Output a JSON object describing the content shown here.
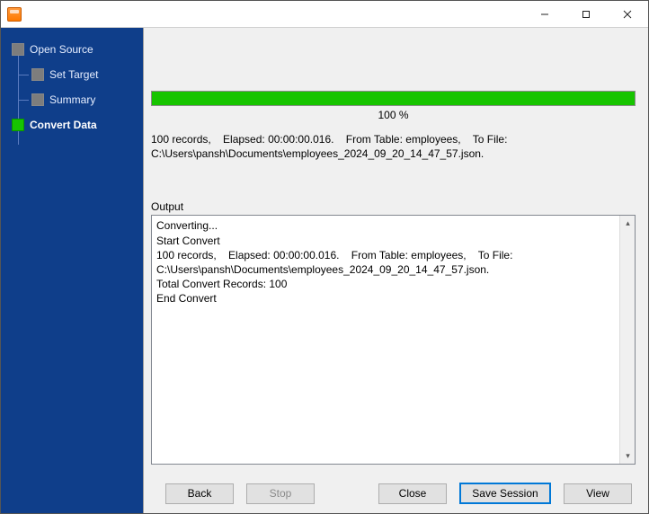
{
  "sidebar": {
    "items": [
      {
        "label": "Open Source"
      },
      {
        "label": "Set Target"
      },
      {
        "label": "Summary"
      },
      {
        "label": "Convert Data"
      }
    ]
  },
  "progress": {
    "percent_label": "100 %"
  },
  "status_line": "100 records,    Elapsed: 00:00:00.016.    From Table: employees,    To File: C:\\Users\\pansh\\Documents\\employees_2024_09_20_14_47_57.json.",
  "output": {
    "label": "Output",
    "text": "Converting...\nStart Convert\n100 records,    Elapsed: 00:00:00.016.    From Table: employees,    To File: C:\\Users\\pansh\\Documents\\employees_2024_09_20_14_47_57.json.\nTotal Convert Records: 100\nEnd Convert"
  },
  "buttons": {
    "back": "Back",
    "stop": "Stop",
    "close": "Close",
    "save_session": "Save Session",
    "view": "View"
  }
}
